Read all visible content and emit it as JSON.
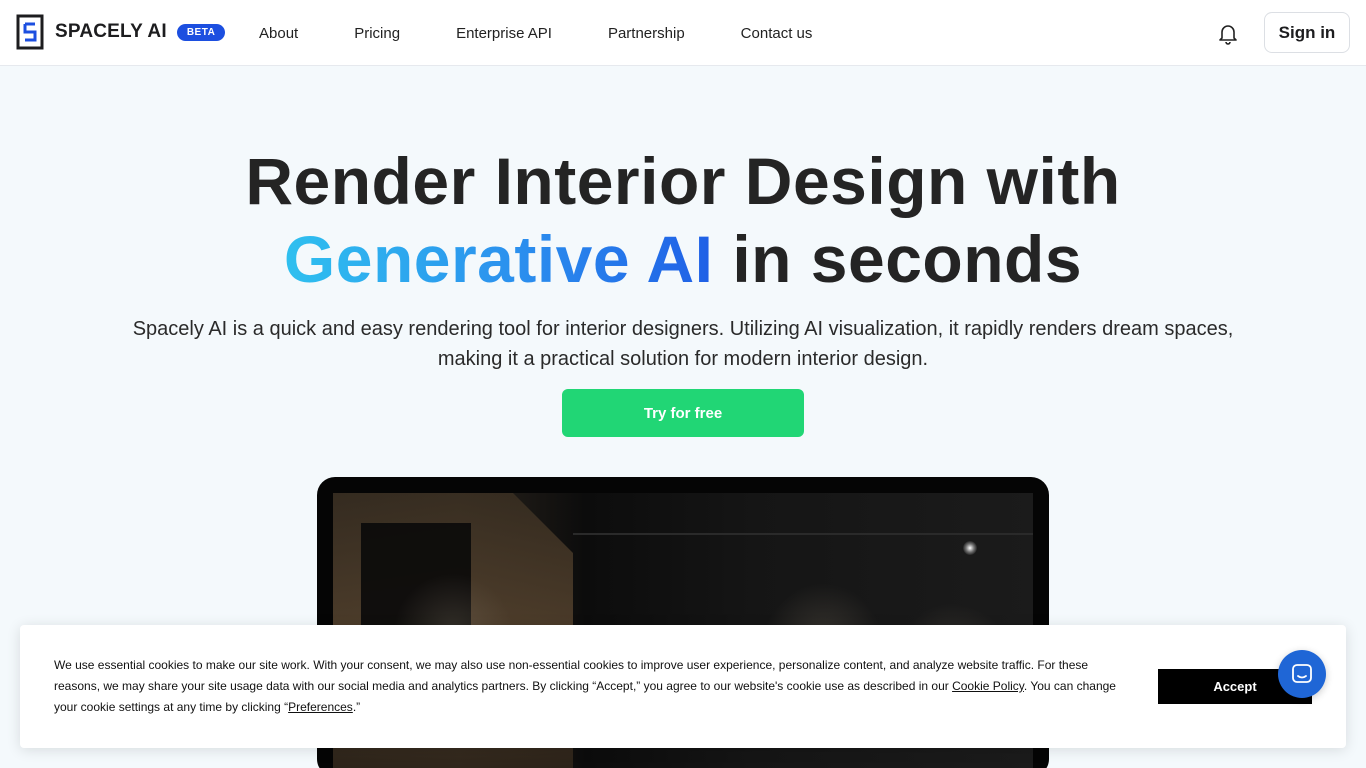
{
  "header": {
    "brand": "SPACELY AI",
    "badge": "BETA",
    "nav": [
      {
        "label": "About"
      },
      {
        "label": "Pricing"
      },
      {
        "label": "Enterprise API"
      },
      {
        "label": "Partnership"
      },
      {
        "label": "Contact us"
      }
    ],
    "signin_label": "Sign in",
    "bell_icon": "bell-icon"
  },
  "hero": {
    "title_line1": "Render Interior Design with",
    "title_highlight": "Generative AI",
    "title_line2_rest": " in seconds",
    "subtitle": "Spacely AI is a quick and easy rendering tool for interior designers. Utilizing AI visualization, it rapidly renders dream spaces, making it a practical solution for modern interior design.",
    "cta_label": "Try for free"
  },
  "cookie": {
    "text_before": "We use essential cookies to make our site work. With your consent, we may also use non-essential cookies to improve user experience, personalize content, and analyze website traffic. For these reasons, we may share your site usage data with our social media and analytics partners. By clicking “Accept,” you agree to our website's cookie use as described in our ",
    "policy_link": "Cookie Policy",
    "text_middle": ". You can change your cookie settings at any time by clicking “",
    "preferences_link": "Preferences",
    "text_after": ".”",
    "accept_label": "Accept"
  },
  "colors": {
    "cta": "#21d675",
    "badge": "#1c4fe0",
    "chat": "#1f66d6",
    "gradient_start": "#2fc0ef",
    "gradient_end": "#1f5fe6"
  }
}
